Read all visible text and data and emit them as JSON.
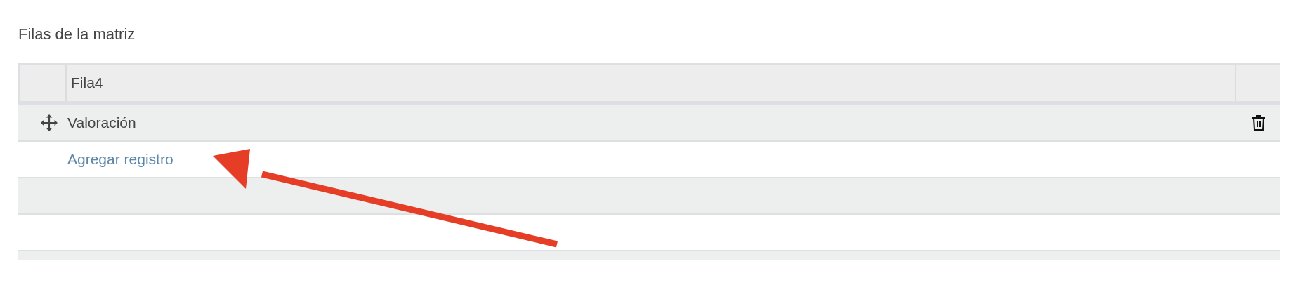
{
  "section": {
    "title": "Filas de la matriz"
  },
  "table": {
    "header": {
      "label": "Fila4"
    },
    "rows": [
      {
        "kind": "item",
        "label": "Valoración"
      },
      {
        "kind": "add",
        "label": "Agregar registro"
      },
      {
        "kind": "empty"
      },
      {
        "kind": "empty"
      },
      {
        "kind": "empty"
      }
    ]
  },
  "annotation": {
    "kind": "arrow"
  }
}
